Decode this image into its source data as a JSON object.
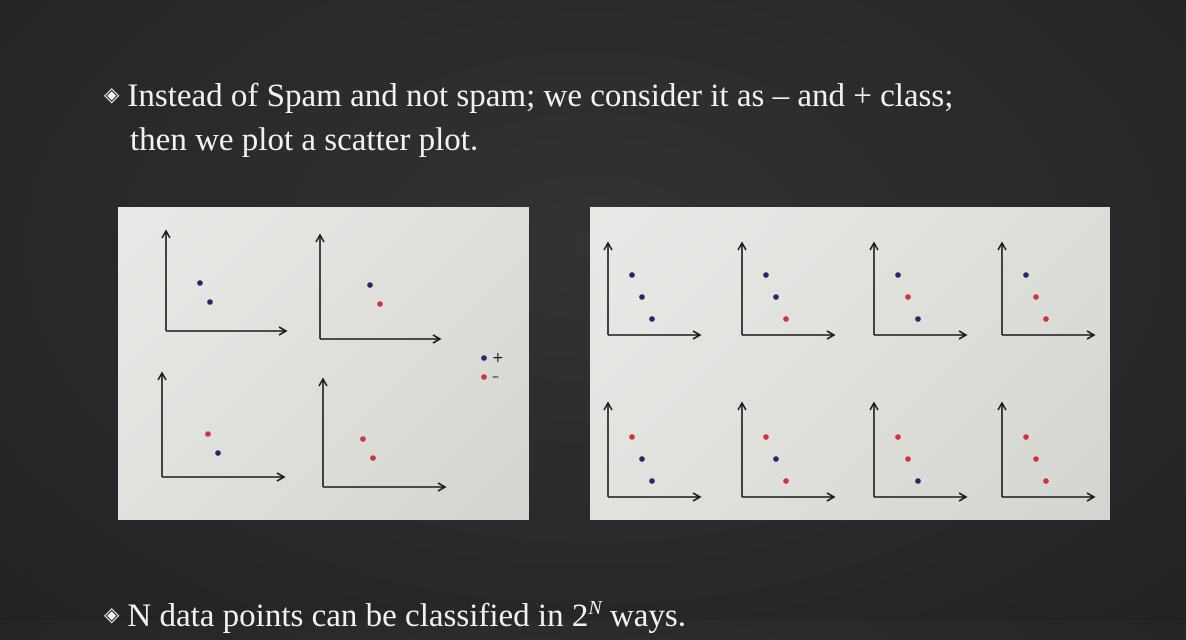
{
  "bullet1": {
    "marker": "◈",
    "line1": "Instead of Spam and not spam; we consider it as – and + class;",
    "line2": "then we plot a scatter plot."
  },
  "bullet2": {
    "marker": "◈",
    "text": "N data points can be classified in 2",
    "superscript": "N",
    "suffix": " ways."
  },
  "legend": {
    "plus": "+",
    "minus": "–"
  },
  "colors": {
    "plus": "#1f2a6b",
    "minus": "#d0333c",
    "ink": "#1a1a1a"
  },
  "photo1_plots": [
    [
      "plus",
      "plus"
    ],
    [
      "plus",
      "minus"
    ],
    [
      "minus",
      "plus"
    ],
    [
      "minus",
      "minus"
    ]
  ],
  "photo2_plots": [
    [
      "plus",
      "plus",
      "plus"
    ],
    [
      "plus",
      "plus",
      "minus"
    ],
    [
      "plus",
      "minus",
      "plus"
    ],
    [
      "plus",
      "minus",
      "minus"
    ],
    [
      "minus",
      "plus",
      "plus"
    ],
    [
      "minus",
      "plus",
      "minus"
    ],
    [
      "minus",
      "minus",
      "plus"
    ],
    [
      "minus",
      "minus",
      "minus"
    ]
  ]
}
